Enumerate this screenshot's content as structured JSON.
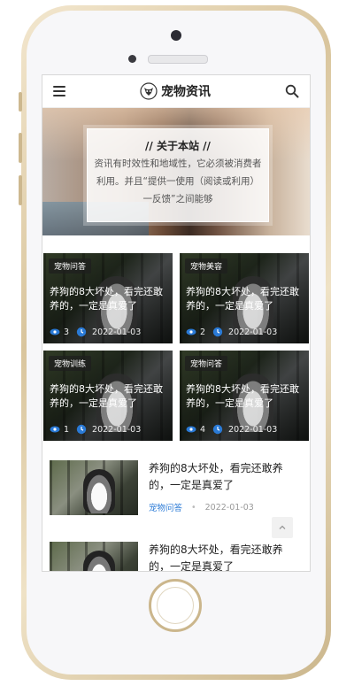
{
  "header": {
    "brand": "宠物资讯"
  },
  "hero": {
    "title": "// 关于本站 //",
    "text": "资讯有时效性和地域性，它必须被消费者利用。并且“提供一使用（阅读或利用）一反馈”之间能够"
  },
  "grid": [
    {
      "tag": "宠物问答",
      "title": "养狗的8大坏处，看完还敢养的，一定是真爱了",
      "views": "3",
      "date": "2022-01-03"
    },
    {
      "tag": "宠物美容",
      "title": "养狗的8大坏处，看完还敢养的，一定是真爱了",
      "views": "2",
      "date": "2022-01-03"
    },
    {
      "tag": "宠物训练",
      "title": "养狗的8大坏处，看完还敢养的，一定是真爱了",
      "views": "1",
      "date": "2022-01-03"
    },
    {
      "tag": "宠物问答",
      "title": "养狗的8大坏处，看完还敢养的，一定是真爱了",
      "views": "4",
      "date": "2022-01-03"
    }
  ],
  "list": [
    {
      "title": "养狗的8大坏处，看完还敢养的，一定是真爱了",
      "category": "宠物问答",
      "dot": "•",
      "date": "2022-01-03"
    },
    {
      "title": "养狗的8大坏处，看完还敢养的，一定是真爱了"
    }
  ],
  "icons": {
    "menu": "menu-icon",
    "search": "search-icon",
    "views": "eye-icon",
    "clock": "clock-icon",
    "back_top": "chevron-up-icon"
  },
  "colors": {
    "accent": "#2a7ad6",
    "frame_gold": "#cbb68c"
  }
}
